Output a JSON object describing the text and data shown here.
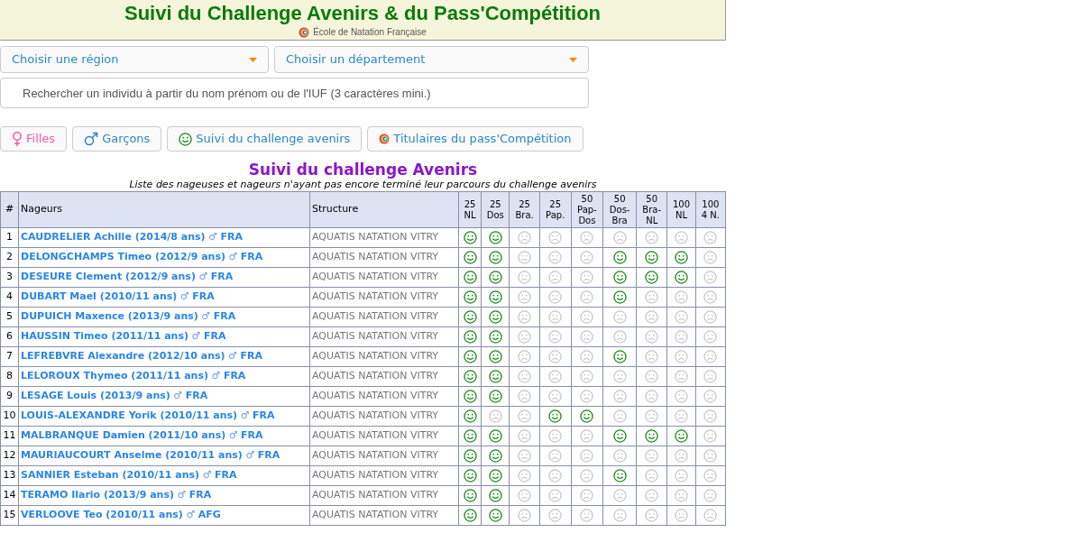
{
  "header": {
    "title": "Suivi du Challenge Avenirs & du Pass'Compétition",
    "subtitle": "École de Natation Française"
  },
  "filters": {
    "region": "Choisir une région",
    "departement": "Choisir un département",
    "search_placeholder": "Rechercher un individu à partir du nom prénom ou de l'IUF (3 caractères mini.)"
  },
  "buttons": [
    {
      "kind": "female",
      "label": "Filles"
    },
    {
      "kind": "male",
      "label": "Garçons"
    },
    {
      "kind": "smiley",
      "label": "Suivi du challenge avenirs"
    },
    {
      "kind": "logo",
      "label": "Titulaires du pass'Compétition"
    }
  ],
  "section": {
    "title": "Suivi du challenge Avenirs",
    "subtitle": "Liste des nageuses et nageurs n'ayant pas encore terminé leur parcours du challenge avenirs"
  },
  "table": {
    "columns": [
      "#",
      "Nageurs",
      "Structure"
    ],
    "events": [
      [
        "25",
        "NL"
      ],
      [
        "25",
        "Dos"
      ],
      [
        "25",
        "Bra."
      ],
      [
        "25",
        "Pap."
      ],
      [
        "50",
        "Pap-",
        "Dos"
      ],
      [
        "50",
        "Dos-",
        "Bra"
      ],
      [
        "50",
        "Bra-",
        "NL"
      ],
      [
        "100",
        "NL"
      ],
      [
        "100",
        "4 N."
      ]
    ],
    "rows": [
      {
        "num": "1",
        "name": "CAUDRELIER Achille (2014/8 ans)",
        "gender": "♂",
        "nation": "FRA",
        "structure": "AQUATIS NATATION VITRY",
        "results": [
          true,
          true,
          false,
          false,
          false,
          false,
          false,
          false,
          false
        ]
      },
      {
        "num": "2",
        "name": "DELONGCHAMPS Timeo (2012/9 ans)",
        "gender": "♂",
        "nation": "FRA",
        "structure": "AQUATIS NATATION VITRY",
        "results": [
          true,
          true,
          false,
          false,
          false,
          true,
          true,
          true,
          false
        ]
      },
      {
        "num": "3",
        "name": "DESEURE Clement (2012/9 ans)",
        "gender": "♂",
        "nation": "FRA",
        "structure": "AQUATIS NATATION VITRY",
        "results": [
          true,
          true,
          false,
          false,
          false,
          true,
          true,
          true,
          false
        ]
      },
      {
        "num": "4",
        "name": "DUBART Mael (2010/11 ans)",
        "gender": "♂",
        "nation": "FRA",
        "structure": "AQUATIS NATATION VITRY",
        "results": [
          true,
          true,
          false,
          false,
          false,
          true,
          false,
          false,
          false
        ]
      },
      {
        "num": "5",
        "name": "DUPUICH Maxence (2013/9 ans)",
        "gender": "♂",
        "nation": "FRA",
        "structure": "AQUATIS NATATION VITRY",
        "results": [
          true,
          true,
          false,
          false,
          false,
          false,
          false,
          false,
          false
        ]
      },
      {
        "num": "6",
        "name": "HAUSSIN Timeo (2011/11 ans)",
        "gender": "♂",
        "nation": "FRA",
        "structure": "AQUATIS NATATION VITRY",
        "results": [
          true,
          true,
          false,
          false,
          false,
          false,
          false,
          false,
          false
        ]
      },
      {
        "num": "7",
        "name": "LEFREBVRE Alexandre (2012/10 ans)",
        "gender": "♂",
        "nation": "FRA",
        "structure": "AQUATIS NATATION VITRY",
        "results": [
          true,
          true,
          false,
          false,
          false,
          true,
          false,
          false,
          false
        ]
      },
      {
        "num": "8",
        "name": "LELOROUX Thymeo (2011/11 ans)",
        "gender": "♂",
        "nation": "FRA",
        "structure": "AQUATIS NATATION VITRY",
        "results": [
          true,
          true,
          false,
          false,
          false,
          false,
          false,
          false,
          false
        ]
      },
      {
        "num": "9",
        "name": "LESAGE Louis (2013/9 ans)",
        "gender": "♂",
        "nation": "FRA",
        "structure": "AQUATIS NATATION VITRY",
        "results": [
          true,
          true,
          false,
          false,
          false,
          false,
          false,
          false,
          false
        ]
      },
      {
        "num": "10",
        "name": "LOUIS-ALEXANDRE Yorik (2010/11 ans)",
        "gender": "♂",
        "nation": "FRA",
        "structure": "AQUATIS NATATION VITRY",
        "results": [
          true,
          false,
          false,
          true,
          true,
          false,
          false,
          false,
          false
        ]
      },
      {
        "num": "11",
        "name": "MALBRANQUE Damien (2011/10 ans)",
        "gender": "♂",
        "nation": "FRA",
        "structure": "AQUATIS NATATION VITRY",
        "results": [
          true,
          true,
          false,
          false,
          false,
          true,
          true,
          true,
          false
        ]
      },
      {
        "num": "12",
        "name": "MAURIAUCOURT Anselme (2010/11 ans)",
        "gender": "♂",
        "nation": "FRA",
        "structure": "AQUATIS NATATION VITRY",
        "results": [
          true,
          true,
          false,
          false,
          false,
          false,
          false,
          false,
          false
        ]
      },
      {
        "num": "13",
        "name": "SANNIER Esteban (2010/11 ans)",
        "gender": "♂",
        "nation": "FRA",
        "structure": "AQUATIS NATATION VITRY",
        "results": [
          true,
          true,
          false,
          false,
          false,
          true,
          false,
          false,
          false
        ]
      },
      {
        "num": "14",
        "name": "TERAMO Ilario (2013/9 ans)",
        "gender": "♂",
        "nation": "FRA",
        "structure": "AQUATIS NATATION VITRY",
        "results": [
          true,
          true,
          false,
          false,
          false,
          false,
          false,
          false,
          false
        ]
      },
      {
        "num": "15",
        "name": "VERLOOVE Teo (2010/11 ans)",
        "gender": "♂",
        "nation": "AFG",
        "structure": "AQUATIS NATATION VITRY",
        "results": [
          true,
          true,
          false,
          false,
          false,
          false,
          false,
          false,
          false
        ]
      }
    ]
  }
}
